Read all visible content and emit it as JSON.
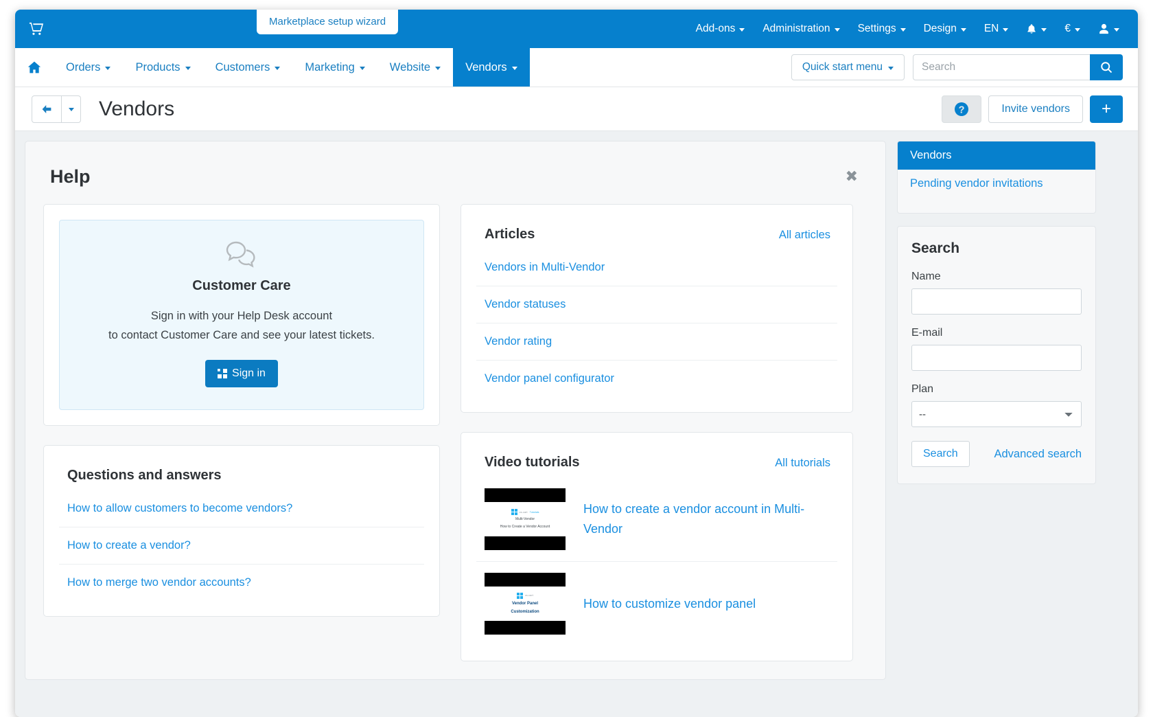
{
  "topbar": {
    "cart_icon": "cart-icon",
    "wizard_pill": "Marketplace setup wizard",
    "items": [
      {
        "label": "Add-ons",
        "caret": true
      },
      {
        "label": "Administration",
        "caret": true
      },
      {
        "label": "Settings",
        "caret": true
      },
      {
        "label": "Design",
        "caret": true
      },
      {
        "label": "EN",
        "caret": true
      },
      {
        "label": "",
        "icon": "bell-icon",
        "caret": true
      },
      {
        "label": "€",
        "caret": true
      },
      {
        "label": "",
        "icon": "user-icon",
        "caret": true
      }
    ]
  },
  "menubar": {
    "home_icon": "home-icon",
    "items": [
      {
        "label": "Orders"
      },
      {
        "label": "Products"
      },
      {
        "label": "Customers"
      },
      {
        "label": "Marketing"
      },
      {
        "label": "Website"
      },
      {
        "label": "Vendors"
      }
    ],
    "active_index": 5,
    "quick_start": "Quick start menu",
    "search_placeholder": "Search",
    "search_value": ""
  },
  "titlebar": {
    "title": "Vendors",
    "back_icon": "arrow-left-icon",
    "help_icon": "question-circle-icon",
    "invite_label": "Invite vendors",
    "plus_label": "+"
  },
  "help": {
    "heading": "Help",
    "close_label": "✖",
    "customer_care": {
      "icon": "chat-bubbles-icon",
      "title": "Customer Care",
      "line1": "Sign in with your Help Desk account",
      "line2": "to contact Customer Care and see your latest tickets.",
      "signin_label": "Sign in",
      "signin_icon": "microsoft-logo-icon"
    },
    "articles": {
      "title": "Articles",
      "link": "All articles",
      "items": [
        "Vendors in Multi-Vendor",
        "Vendor statuses",
        "Vendor rating",
        "Vendor panel configurator"
      ]
    },
    "qa": {
      "title": "Questions and answers",
      "items": [
        "How to allow customers to become vendors?",
        "How to create a vendor?",
        "How to merge two vendor accounts?"
      ]
    },
    "videos": {
      "title": "Video tutorials",
      "link": "All tutorials",
      "items": [
        {
          "title": "How to create a vendor account in Multi-Vendor",
          "thumb_brand": "cs-cart",
          "thumb_brand_sub": "Tutorials",
          "thumb_line1": "Multi-Vendor",
          "thumb_line2": "How to Create a Vendor Account"
        },
        {
          "title": "How to customize vendor panel",
          "thumb_brand": "cs-cart",
          "thumb_brand_sub": "",
          "thumb_line1": "Vendor Panel",
          "thumb_line2": "Customization"
        }
      ]
    }
  },
  "sidebar": {
    "nav": [
      {
        "label": "Vendors",
        "active": true
      },
      {
        "label": "Pending vendor invitations",
        "active": false
      }
    ],
    "search": {
      "title": "Search",
      "name_label": "Name",
      "name_value": "",
      "email_label": "E-mail",
      "email_value": "",
      "plan_label": "Plan",
      "plan_value": "--",
      "plan_options": [
        "--"
      ],
      "search_button": "Search",
      "advanced_link": "Advanced search"
    }
  },
  "colors": {
    "brand_blue": "#0680cd",
    "link_blue": "#1a8fe0",
    "page_bg": "#eef1f3"
  }
}
